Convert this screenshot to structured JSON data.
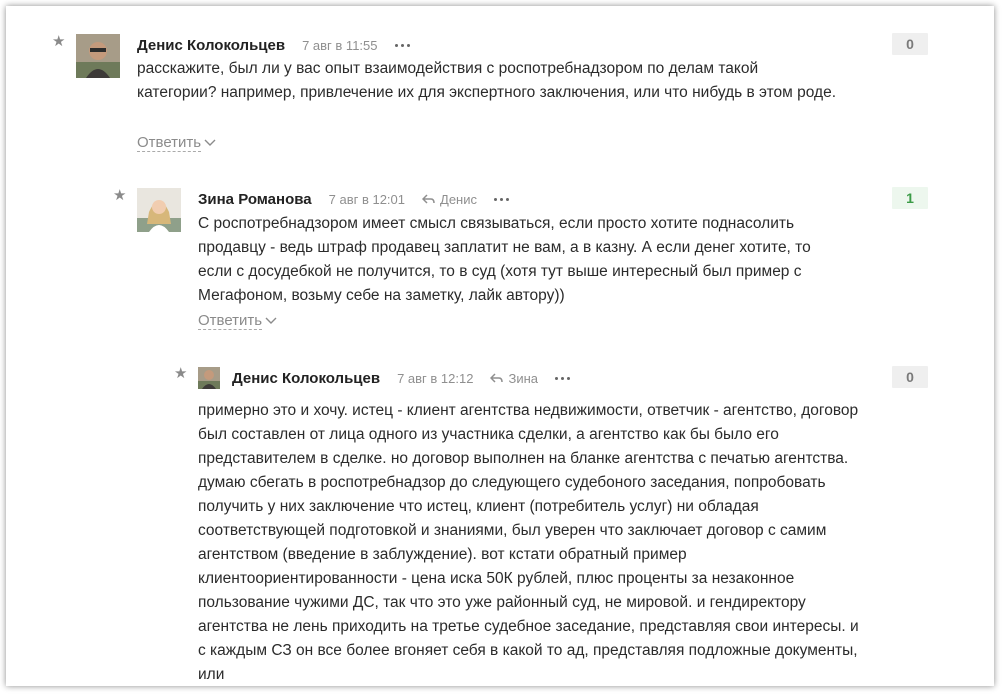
{
  "comments": [
    {
      "author": "Денис Колокольцев",
      "date": "7 авг в 11:55",
      "reply_to": "",
      "text": "расскажите, был ли у вас опыт взаимодействия с роспотребнадзором по делам такой категории? например, привлечение их для экспертного заключения, или что нибудь в этом роде.",
      "reply_label": "Ответить",
      "score": "0"
    },
    {
      "author": "Зина Романова",
      "date": "7 авг в 12:01",
      "reply_to": "Денис",
      "text": "С роспотребнадзором имеет смысл связываться, если просто хотите поднасолить продавцу - ведь штраф продавец заплатит не вам, а в казну. А если денег хотите, то если с досудебкой не получится, то в суд (хотя тут выше интересный был пример с Мегафоном, возьму себе на заметку, лайк автору))",
      "reply_label": "Ответить",
      "score": "1"
    },
    {
      "author": "Денис Колокольцев",
      "date": "7 авг в 12:12",
      "reply_to": "Зина",
      "text": "примерно это и хочу. истец - клиент агентства недвижимости, ответчик - агентство, договор был составлен от лица одного из участника сделки, а агентство как бы было его представителем в сделке. но договор выполнен на бланке агентства с печатью агентства. думаю сбегать в роспотребнадзор до следующего судебоного заседания, попробовать получить у них заключение что истец, клиент (потребитель услуг) ни обладая соответствующей подготовкой и знаниями, был уверен что заключает договор с самим агентством (введение в заблуждение). вот кстати обратный пример клиентоориентированности - цена иска 50К рублей, плюс проценты за незаконное пользование чужими ДС, так что это уже районный суд, не мировой. и гендиректору агентства не лень приходить на третье судебное заседание, представляя свои интересы. и с каждым СЗ он все более вгоняет себя в какой то ад, представляя подложные документы, или",
      "score": "0"
    }
  ],
  "colors": {
    "score_positive_text": "#3b9b46",
    "score_positive_bg": "#edf7ee",
    "score_neutral_bg": "#efefef"
  }
}
